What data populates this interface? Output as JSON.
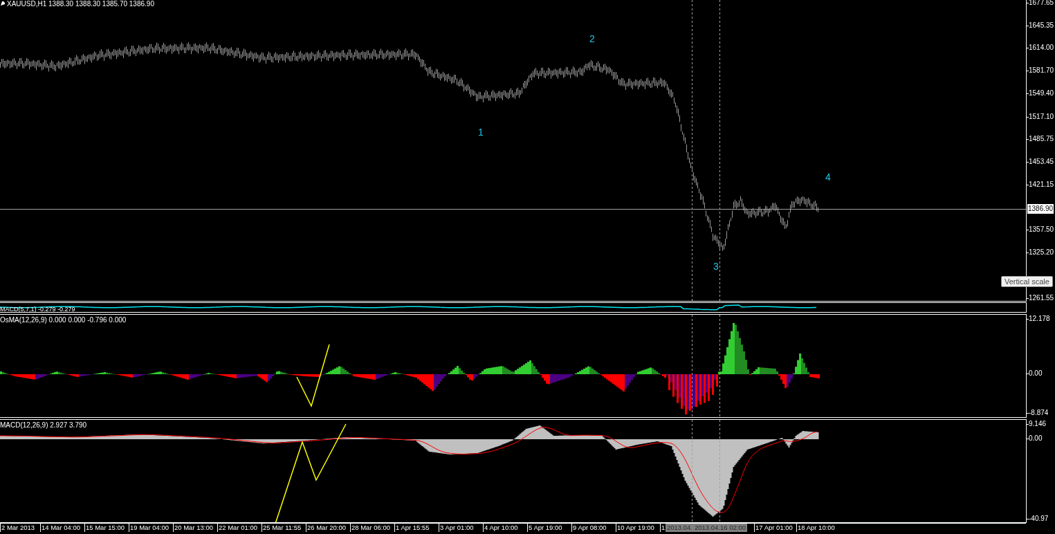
{
  "chart": {
    "header": "XAUUSD,H1  1388.30 1388.30 1385.70 1386.90",
    "wave_labels": [
      "1",
      "2",
      "3",
      "4"
    ],
    "price_scale": [
      "1677.65",
      "1645.35",
      "1614.00",
      "1581.70",
      "1549.40",
      "1517.10",
      "1485.75",
      "1453.45",
      "1421.15",
      "1357.50",
      "1325.20",
      "1261.55"
    ],
    "current_price": "1386.90",
    "tooltip": "Vertical scale"
  },
  "indicators": [
    {
      "kind": "macd_line",
      "label": "MACD(5,7,1) -0.279 -0.279"
    },
    {
      "kind": "osma",
      "label": "OsMA(12,26,9) 0.000 0.000 -0.796 0.000",
      "scale": [
        "12.178",
        "0.00",
        "-8.874"
      ]
    },
    {
      "kind": "macd",
      "label": "MACD(12,26,9) 2.927 3.790",
      "scale": [
        "9.146",
        "0.00",
        "-40.97"
      ]
    }
  ],
  "time_axis": [
    {
      "kind": "tick",
      "label": "2 Mar 2013"
    },
    {
      "kind": "tick",
      "label": "14 Mar 04:00"
    },
    {
      "kind": "tick",
      "label": "15 Mar 15:00"
    },
    {
      "kind": "tick",
      "label": "19 Mar 04:00"
    },
    {
      "kind": "tick",
      "label": "20 Mar 13:00"
    },
    {
      "kind": "tick",
      "label": "22 Mar 01:00"
    },
    {
      "kind": "tick",
      "label": "25 Mar 11:55"
    },
    {
      "kind": "tick",
      "label": "26 Mar 20:00"
    },
    {
      "kind": "tick",
      "label": "28 Mar 06:00"
    },
    {
      "kind": "tick",
      "label": "1 Apr 15:55"
    },
    {
      "kind": "tick",
      "label": "3 Apr 01:00"
    },
    {
      "kind": "tick",
      "label": "4 Apr 10:00"
    },
    {
      "kind": "tick",
      "label": "5 Apr 19:00"
    },
    {
      "kind": "tick",
      "label": "9 Apr 08:00"
    },
    {
      "kind": "tick",
      "label": "10 Apr 19:00"
    },
    {
      "kind": "tick",
      "label": "1"
    },
    {
      "kind": "cursor",
      "label": "2013.04.",
      "value": "2013.04.16 02:00"
    },
    {
      "kind": "tick",
      "label": "17 Apr 01:00"
    },
    {
      "kind": "tick",
      "label": "18 Apr 10:00"
    }
  ]
}
